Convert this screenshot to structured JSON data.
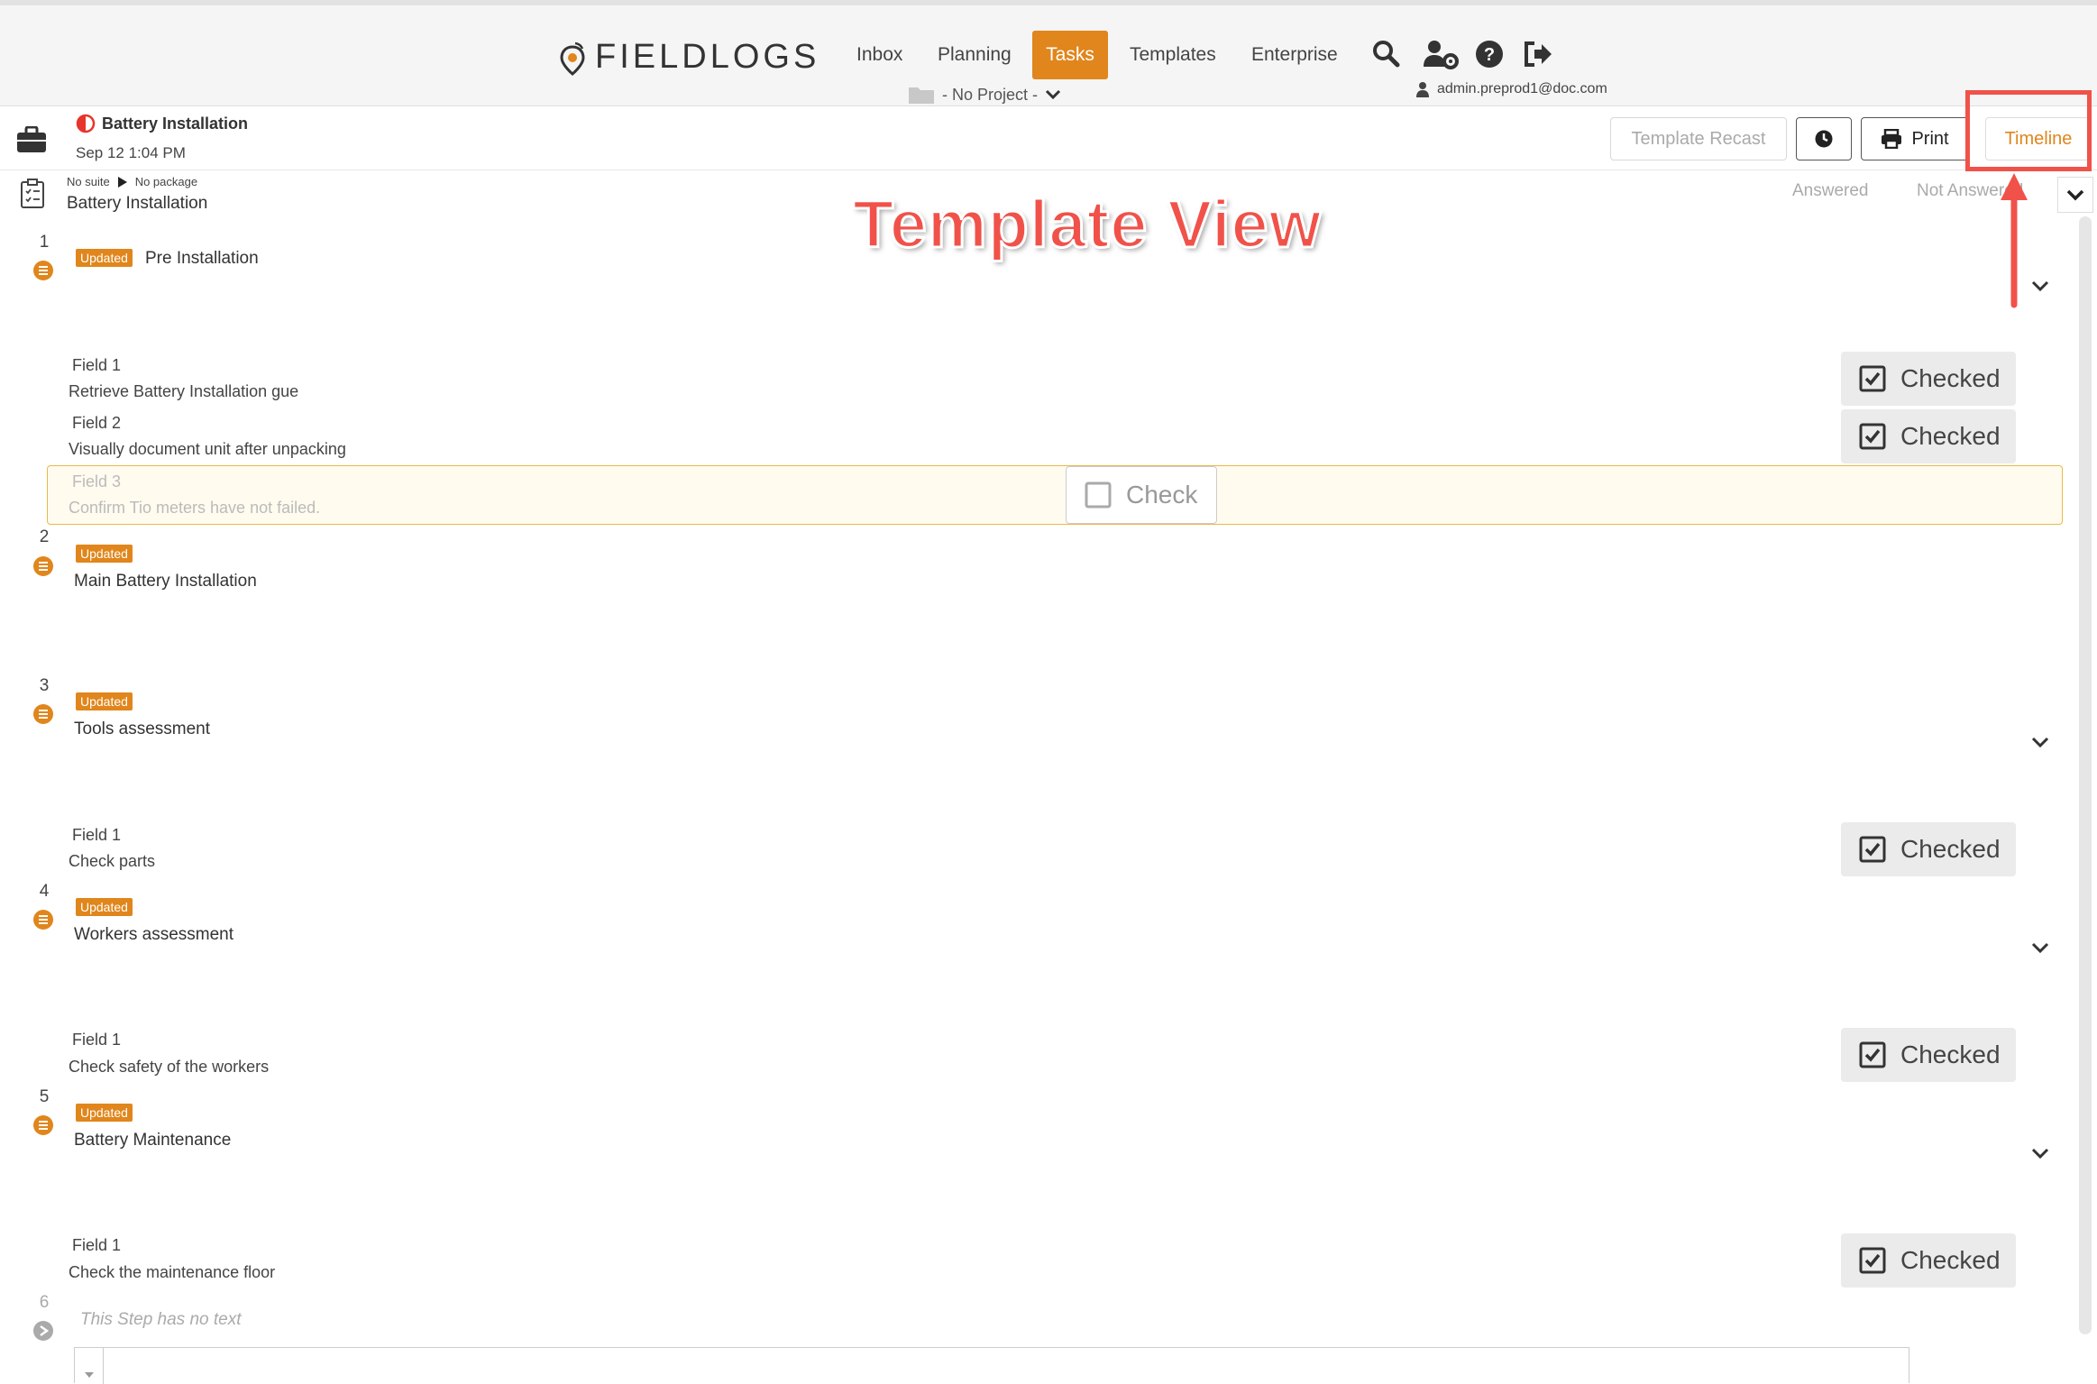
{
  "nav": {
    "logo": "FIELDLOGS",
    "items": [
      "Inbox",
      "Planning",
      "Tasks",
      "Templates",
      "Enterprise"
    ],
    "active": "Tasks",
    "project": "- No Project -",
    "user": "admin.preprod1@doc.com"
  },
  "task": {
    "title": "Battery Installation",
    "date": "Sep 12 1:04 PM",
    "suite": "No suite",
    "package": "No package",
    "name": "Battery Installation"
  },
  "buttons": {
    "template_recast": "Template Recast",
    "print": "Print",
    "timeline": "Timeline"
  },
  "filters": {
    "answered": "Answered",
    "not_answered": "Not Answered"
  },
  "annotation": {
    "title": "Template View",
    "highlight_color": "#f0524a"
  },
  "badge_label": "Updated",
  "checked_label": "Checked",
  "check_label": "Check",
  "steps": [
    {
      "num": "1",
      "title": "Pre Installation"
    },
    {
      "num": "2",
      "title": "Main Battery Installation"
    },
    {
      "num": "3",
      "title": "Tools assessment"
    },
    {
      "num": "4",
      "title": "Workers assessment"
    },
    {
      "num": "5",
      "title": "Battery Maintenance"
    },
    {
      "num": "6",
      "title": "This Step has no text"
    }
  ],
  "fields": [
    {
      "label": "Field 1",
      "text": "Retrieve Battery Installation gue"
    },
    {
      "label": "Field 2",
      "text": "Visually document unit after unpacking"
    },
    {
      "label": "Field 3",
      "text": "Confirm Tio meters have not failed."
    },
    {
      "label": "Field 1",
      "text": "Check parts"
    },
    {
      "label": "Field 1",
      "text": "Check safety of the workers"
    },
    {
      "label": "Field 1",
      "text": "Check the maintenance floor"
    }
  ],
  "colors": {
    "accent": "#e0861c",
    "annotation_red": "#f0524a",
    "field_highlight_bg": "#fffbef",
    "field_highlight_border": "#e9b94a"
  }
}
